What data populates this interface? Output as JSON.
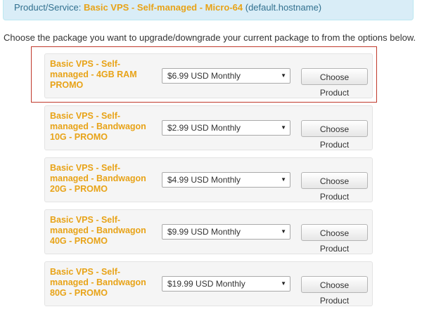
{
  "header": {
    "label": "Product/Service: ",
    "product_name": "Basic VPS - Self-managed - Micro-64",
    "hostname": " (default.hostname)"
  },
  "instructions": "Choose the package you want to upgrade/downgrade your current package to from the options below.",
  "products": [
    {
      "title": "Basic VPS - Self-managed - 4GB RAM PROMO",
      "price": "$6.99 USD Monthly",
      "button": "Choose Product",
      "highlighted": true
    },
    {
      "title": "Basic VPS - Self-managed - Bandwagon 10G - PROMO",
      "price": "$2.99 USD Monthly",
      "button": "Choose Product"
    },
    {
      "title": "Basic VPS - Self-managed - Bandwagon 20G - PROMO",
      "price": "$4.99 USD Monthly",
      "button": "Choose Product"
    },
    {
      "title": "Basic VPS - Self-managed - Bandwagon 40G - PROMO",
      "price": "$9.99 USD Monthly",
      "button": "Choose Product"
    },
    {
      "title": "Basic VPS - Self-managed - Bandwagon 80G - PROMO",
      "price": "$19.99 USD Monthly",
      "button": "Choose Product"
    }
  ],
  "colors": {
    "accent": "#e8a317",
    "info_bg": "#d9edf7",
    "highlight_border": "#c0392b"
  }
}
